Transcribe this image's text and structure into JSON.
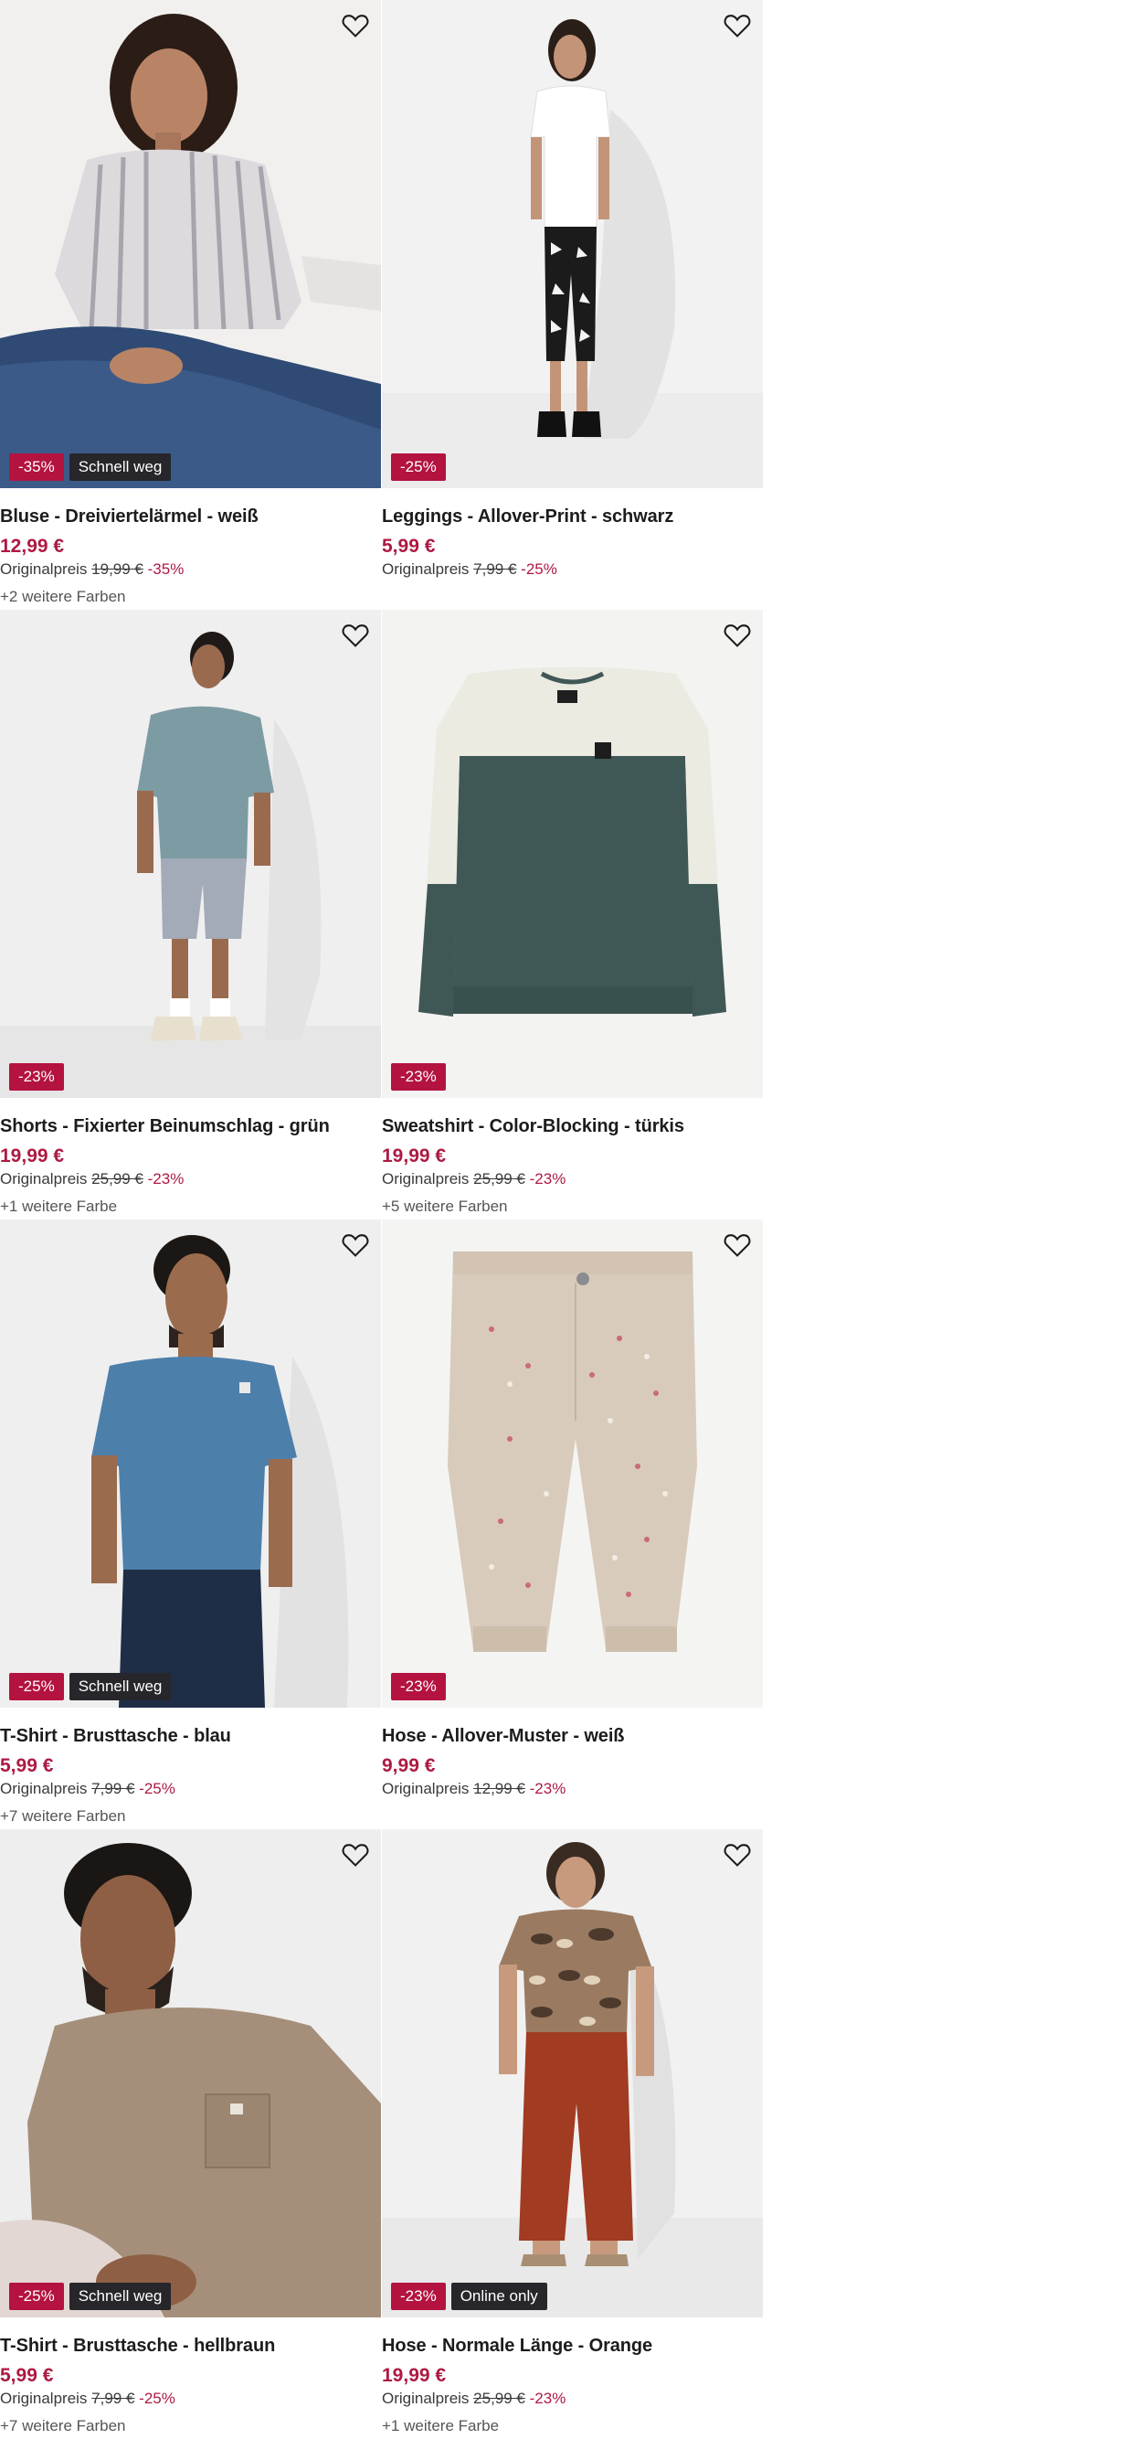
{
  "products": [
    {
      "title": "Bluse - Dreiviertelärmel - weiß",
      "price": "12,99 €",
      "orig_label": "Originalpreis",
      "orig_price": "19,99 €",
      "orig_discount": "-35%",
      "colors": "+2 weitere Farben",
      "badge_discount": "-35%",
      "badge_tag": "Schnell weg",
      "image": "woman-striped-blouse"
    },
    {
      "title": "Leggings - Allover-Print - schwarz",
      "price": "5,99 €",
      "orig_label": "Originalpreis",
      "orig_price": "7,99 €",
      "orig_discount": "-25%",
      "colors": "",
      "badge_discount": "-25%",
      "badge_tag": "",
      "image": "woman-leggings"
    },
    {
      "title": "Shorts - Fixierter Beinumschlag - grün",
      "price": "19,99 €",
      "orig_label": "Originalpreis",
      "orig_price": "25,99 €",
      "orig_discount": "-23%",
      "colors": "+1 weitere Farbe",
      "badge_discount": "-23%",
      "badge_tag": "",
      "image": "man-shorts"
    },
    {
      "title": "Sweatshirt - Color-Blocking - türkis",
      "price": "19,99 €",
      "orig_label": "Originalpreis",
      "orig_price": "25,99 €",
      "orig_discount": "-23%",
      "colors": "+5 weitere Farben",
      "badge_discount": "-23%",
      "badge_tag": "",
      "image": "sweatshirt-flat"
    },
    {
      "title": "T-Shirt - Brusttasche - blau",
      "price": "5,99 €",
      "orig_label": "Originalpreis",
      "orig_price": "7,99 €",
      "orig_discount": "-25%",
      "colors": "+7 weitere Farben",
      "badge_discount": "-25%",
      "badge_tag": "Schnell weg",
      "image": "man-blue-tshirt"
    },
    {
      "title": "Hose - Allover-Muster - weiß",
      "price": "9,99 €",
      "orig_label": "Originalpreis",
      "orig_price": "12,99 €",
      "orig_discount": "-23%",
      "colors": "",
      "badge_discount": "-23%",
      "badge_tag": "",
      "image": "kids-trousers-flat"
    },
    {
      "title": "T-Shirt - Brusttasche - hellbraun",
      "price": "5,99 €",
      "orig_label": "Originalpreis",
      "orig_price": "7,99 €",
      "orig_discount": "-25%",
      "colors": "+7 weitere Farben",
      "badge_discount": "-25%",
      "badge_tag": "Schnell weg",
      "image": "man-beige-tshirt"
    },
    {
      "title": "Hose - Normale Länge - Orange",
      "price": "19,99 €",
      "orig_label": "Originalpreis",
      "orig_price": "25,99 €",
      "orig_discount": "-23%",
      "colors": "+1 weitere Farbe",
      "badge_discount": "-23%",
      "badge_tag": "Online only",
      "image": "woman-orange-trousers"
    }
  ],
  "icons": {
    "wishlist": "heart-outline-icon"
  },
  "colors": {
    "price": "#ad1a42",
    "discount_badge": "#b4123f",
    "tag_badge": "#26262b"
  }
}
